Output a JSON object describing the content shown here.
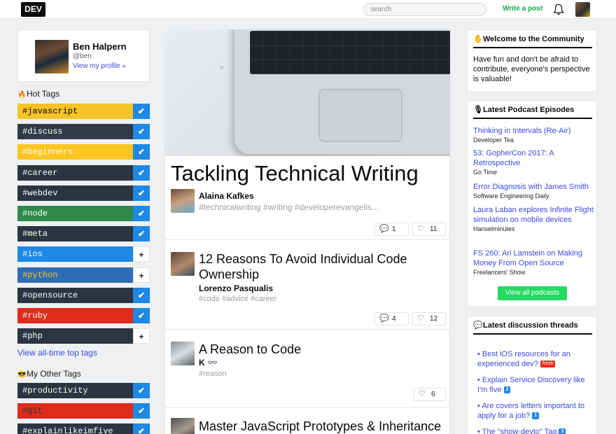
{
  "header": {
    "logo": "DEV",
    "search_placeholder": "search",
    "write_post": "Write a post"
  },
  "profile": {
    "name": "Ben Halpern",
    "handle": "@ben",
    "link": "View my profile »"
  },
  "hot_tags": {
    "title": "Hot Tags",
    "items": [
      {
        "label": "#javascript",
        "bg": "#f7c428",
        "fg": "#000000",
        "followed": true
      },
      {
        "label": "#discuss",
        "bg": "#313b47",
        "fg": "#ffffff",
        "followed": true
      },
      {
        "label": "#beginners",
        "bg": "#fdc521",
        "fg": "#ffffff",
        "followed": true
      },
      {
        "label": "#career",
        "bg": "#2b3440",
        "fg": "#ffffff",
        "followed": true
      },
      {
        "label": "#webdev",
        "bg": "#2b3440",
        "fg": "#ffffff",
        "followed": true
      },
      {
        "label": "#node",
        "bg": "#2f8a4b",
        "fg": "#ffffff",
        "followed": true
      },
      {
        "label": "#meta",
        "bg": "#2b3440",
        "fg": "#ffffff",
        "followed": true
      },
      {
        "label": "#ios",
        "bg": "#1e88e5",
        "fg": "#ffffff",
        "followed": false
      },
      {
        "label": "#python",
        "bg": "#2f6db4",
        "fg": "#f7c428",
        "followed": false
      },
      {
        "label": "#opensource",
        "bg": "#2b3440",
        "fg": "#ffffff",
        "followed": true
      },
      {
        "label": "#ruby",
        "bg": "#e02b1b",
        "fg": "#ffffff",
        "followed": true
      },
      {
        "label": "#php",
        "bg": "#2b3440",
        "fg": "#ffffff",
        "followed": false
      }
    ],
    "view_all": "View all-time top tags"
  },
  "other_tags": {
    "title": "My Other Tags",
    "items": [
      {
        "label": "#productivity",
        "bg": "#2b3440",
        "fg": "#ffffff",
        "followed": true
      },
      {
        "label": "#git",
        "bg": "#e02b1b",
        "fg": "#2b3440",
        "followed": true
      },
      {
        "label": "#explainlikeimfive",
        "bg": "#2b3440",
        "fg": "#ffffff",
        "followed": true
      }
    ]
  },
  "featured": {
    "title": "Tackling Technical Writing",
    "author": "Alaina Kafkes",
    "tags": "#technicalwriting  #writing  #developerevangelis...",
    "comments": "1",
    "reactions": "11"
  },
  "posts": [
    {
      "title": "12 Reasons To Avoid Individual Code Ownership",
      "author": "Lorenzo Pasqualis",
      "tags": "#code  #advice  #career",
      "comments": "4",
      "reactions": "12"
    },
    {
      "title": "A Reason to Code",
      "author": "K 👓",
      "tags": "#reason",
      "reactions": "6"
    },
    {
      "title": "Master JavaScript Prototypes & Inheritance"
    }
  ],
  "welcome": {
    "title": "Welcome to the Community",
    "text": "Have fun and don't be afraid to contribute, everyone's perspective is valuable!"
  },
  "podcasts": {
    "title": "Latest Podcast Episodes",
    "items": [
      {
        "title": "Thinking in Intervals (Re-Air)",
        "show": "Developer Tea"
      },
      {
        "title": "53: GopherCon 2017: A Retrospective",
        "show": "Go Time"
      },
      {
        "title": "Error Diagnosis with James Smith",
        "show": "Software Engineering Daily"
      },
      {
        "title": "Laura Laban explores Infinite Flight simulation on mobile devices",
        "show": "Hanselminutes"
      },
      {
        "title": "FS 260: Ari Lamstein on Making Money From Open Source",
        "show": "Freelancers' Show"
      }
    ],
    "button": "View all podcasts"
  },
  "discussions": {
    "title": "Latest discussion threads",
    "items": [
      {
        "title": "Best iOS resources for an experienced dev?",
        "badge": "fresh"
      },
      {
        "title": "Explain Service Discovery like I'm five",
        "badge": "2"
      },
      {
        "title": "Are covers letters important to apply for a job?",
        "badge": "1"
      },
      {
        "title": "The \"show-devto\" Tag",
        "badge": "3"
      }
    ]
  },
  "colors": {
    "accent": "#3b49df",
    "green": "#26d963",
    "check_blue": "#1e88e5"
  }
}
